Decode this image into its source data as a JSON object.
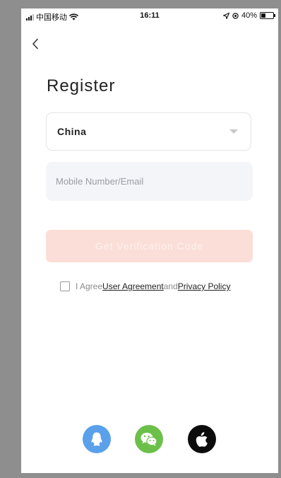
{
  "status_bar": {
    "carrier": "中国移动",
    "time": "16:11",
    "battery_percent": "40%"
  },
  "page": {
    "title": "Register"
  },
  "country": {
    "label": "China"
  },
  "account_input": {
    "placeholder": "Mobile Number/Email",
    "value": ""
  },
  "verify_button": {
    "label": "Get Verification Code",
    "enabled": false
  },
  "agreement": {
    "checked": false,
    "prefix": "I Agree",
    "user_agreement": "User Agreement",
    "and": "and",
    "privacy_policy": "Privacy Policy"
  },
  "social_login": [
    {
      "name": "qq-icon",
      "color": "#5aa0ea"
    },
    {
      "name": "wechat-icon",
      "color": "#6cc04a"
    },
    {
      "name": "apple-icon",
      "color": "#0c0c0c"
    }
  ],
  "colors": {
    "accent_disabled": "#fbded7",
    "input_bg": "#f4f5f8"
  }
}
